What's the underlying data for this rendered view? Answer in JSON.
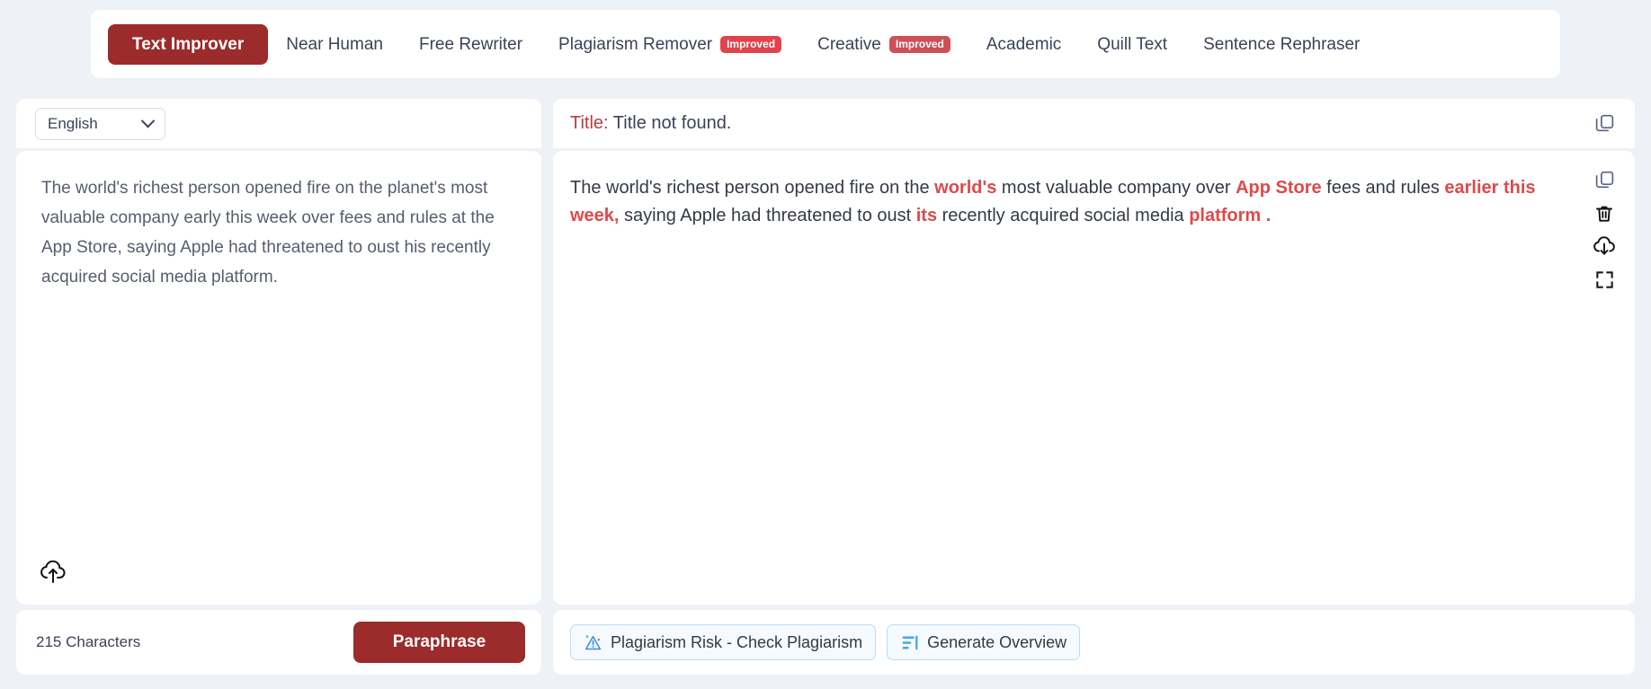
{
  "tabs": [
    {
      "label": "Text Improver",
      "active": true,
      "badge": null
    },
    {
      "label": "Near Human",
      "active": false,
      "badge": null
    },
    {
      "label": "Free Rewriter",
      "active": false,
      "badge": null
    },
    {
      "label": "Plagiarism Remover",
      "active": false,
      "badge": "Improved"
    },
    {
      "label": "Creative",
      "active": false,
      "badge": "Improved"
    },
    {
      "label": "Academic",
      "active": false,
      "badge": null
    },
    {
      "label": "Quill Text",
      "active": false,
      "badge": null
    },
    {
      "label": "Sentence Rephraser",
      "active": false,
      "badge": null
    }
  ],
  "left": {
    "language": "English",
    "input_text": "The world's richest person opened fire on the planet's most valuable company early this week over fees and rules at the App Store, saying Apple had threatened to oust his recently acquired social media platform.",
    "char_count": "215 Characters",
    "paraphrase_label": "Paraphrase",
    "upload_icon": "cloud-upload-icon"
  },
  "right": {
    "title_key": "Title:",
    "title_value": " Title not found.",
    "output_segments": [
      {
        "text": "The world's richest person opened fire on the ",
        "highlight": false
      },
      {
        "text": "world's",
        "highlight": true
      },
      {
        "text": " most valuable company over ",
        "highlight": false
      },
      {
        "text": "App Store",
        "highlight": true
      },
      {
        "text": " fees and rules ",
        "highlight": false
      },
      {
        "text": "earlier this week,",
        "highlight": true
      },
      {
        "text": " saying Apple had threatened to oust ",
        "highlight": false
      },
      {
        "text": "its",
        "highlight": true
      },
      {
        "text": " recently acquired social media ",
        "highlight": false
      },
      {
        "text": "platform .",
        "highlight": true
      }
    ],
    "icons": [
      "copy-icon",
      "trash-icon",
      "cloud-download-icon",
      "fullscreen-icon"
    ],
    "title_copy_icon": "copy-icon",
    "plagiarism_label": "Plagiarism Risk - Check Plagiarism",
    "overview_label": "Generate Overview"
  },
  "colors": {
    "accent_dark_red": "#9c2b2b",
    "highlight_red": "#dd4a4a",
    "badge_red": "#e0434c",
    "page_bg": "#eef1f5",
    "pill_border": "#b9dcf5"
  }
}
